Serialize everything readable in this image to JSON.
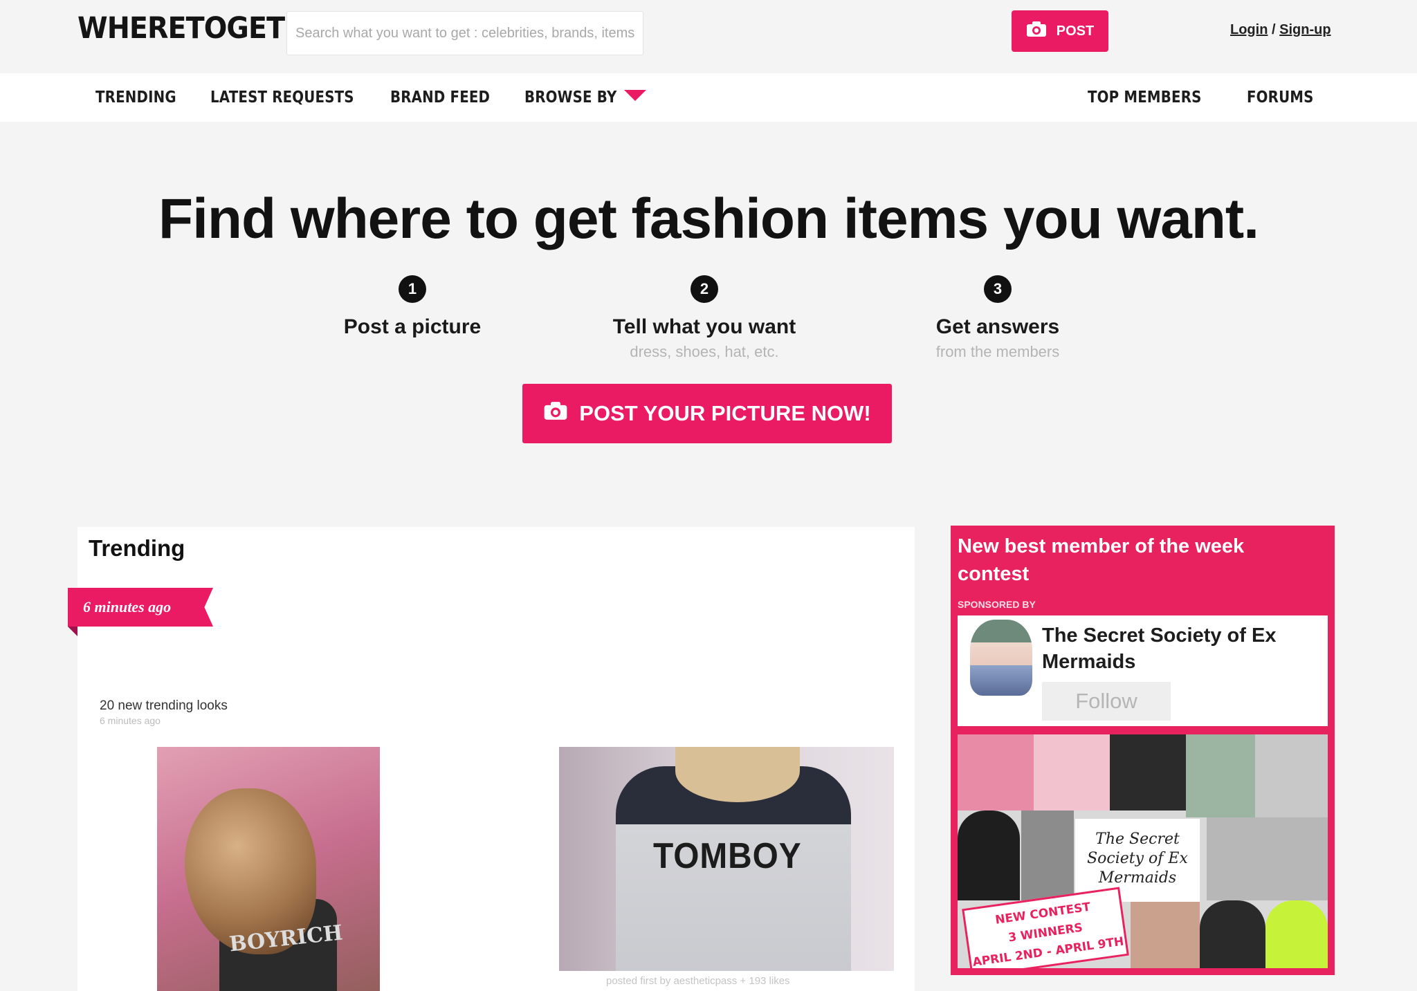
{
  "header": {
    "logo": "WHERETOGET",
    "search_placeholder": "Search what you want to get : celebrities, brands, items...",
    "post_label": "POST",
    "login_label": "Login",
    "auth_separator": " / ",
    "signup_label": "Sign-up"
  },
  "nav": {
    "items": [
      "TRENDING",
      "LATEST REQUESTS",
      "BRAND FEED",
      "BROWSE BY"
    ],
    "right_items": [
      "TOP MEMBERS",
      "FORUMS"
    ]
  },
  "hero": {
    "title": "Find where to get fashion items you want.",
    "steps": [
      {
        "num": "1",
        "title": "Post a picture",
        "sub": ""
      },
      {
        "num": "2",
        "title": "Tell what you want",
        "sub": "dress, shoes, hat, etc."
      },
      {
        "num": "3",
        "title": "Get answers",
        "sub": "from the members"
      }
    ],
    "cta_label": "POST YOUR PICTURE NOW!"
  },
  "trending": {
    "title": "Trending",
    "ribbon": "6 minutes ago",
    "looks_count": "20 new trending looks",
    "looks_time": "6 minutes ago",
    "photo1_text": "BOYRICH",
    "photo2_text": "TOMBOY",
    "photo2_caption": "posted first by aestheticpass + 193 likes"
  },
  "contest": {
    "title": "New best member of the week contest",
    "sponsored_by": "SPONSORED BY",
    "sponsor_name": "The Secret Society of Ex Mermaids",
    "follow_label": "Follow",
    "collage_label": "The Secret Society of Ex Mermaids",
    "stamp_lines": [
      "NEW CONTEST",
      "3 WINNERS",
      "APRIL 2ND - APRIL 9TH"
    ]
  },
  "colors": {
    "accent": "#ea1b63",
    "contest_bg": "#e8225f",
    "page_bg": "#f4f4f4"
  },
  "icons": {
    "post": "camera-icon",
    "cta": "camera-icon",
    "browse": "caret-down-icon"
  }
}
